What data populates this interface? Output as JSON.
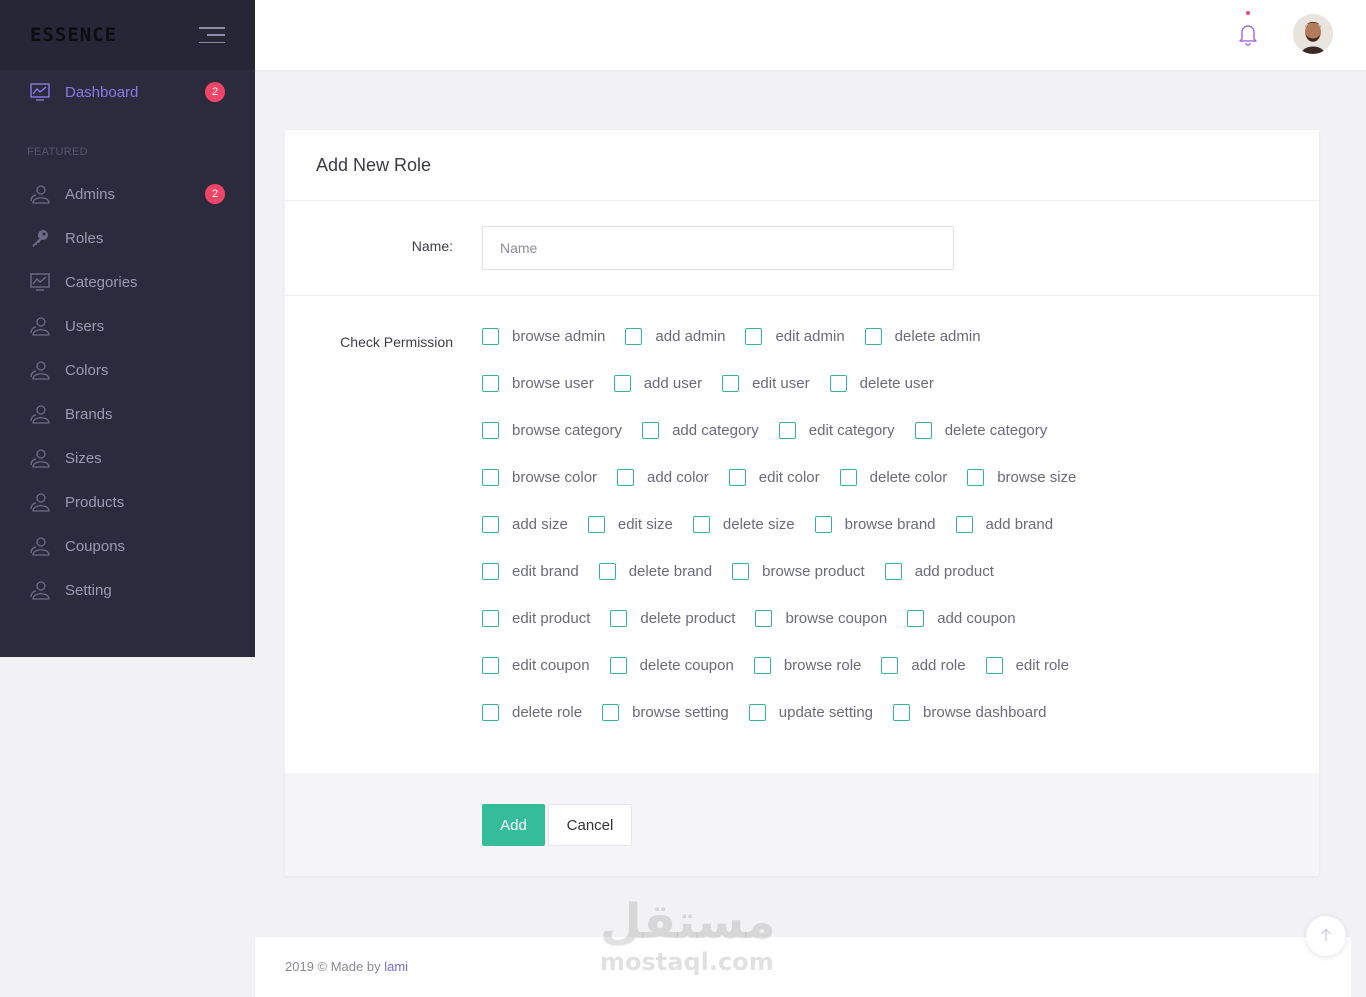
{
  "brand": "ESSENCE",
  "sidebar": {
    "dashboard": {
      "label": "Dashboard",
      "badge": "2"
    },
    "section_title": "FEATURED",
    "items": [
      {
        "label": "Admins",
        "icon": "users-icon",
        "badge": "2"
      },
      {
        "label": "Roles",
        "icon": "key-icon"
      },
      {
        "label": "Categories",
        "icon": "chart-icon"
      },
      {
        "label": "Users",
        "icon": "users-icon"
      },
      {
        "label": "Colors",
        "icon": "users-icon"
      },
      {
        "label": "Brands",
        "icon": "users-icon"
      },
      {
        "label": "Sizes",
        "icon": "users-icon"
      },
      {
        "label": "Products",
        "icon": "users-icon"
      },
      {
        "label": "Coupons",
        "icon": "users-icon"
      },
      {
        "label": "Setting",
        "icon": "users-icon"
      }
    ]
  },
  "form": {
    "title": "Add New Role",
    "name_label": "Name:",
    "name_placeholder": "Name",
    "perm_label": "Check Permission",
    "add_label": "Add",
    "cancel_label": "Cancel",
    "permissions": [
      [
        "browse admin",
        "add admin",
        "edit admin",
        "delete admin"
      ],
      [
        "browse user",
        "add user",
        "edit user",
        "delete user"
      ],
      [
        "browse category",
        "add category",
        "edit category",
        "delete category"
      ],
      [
        "browse color",
        "add color",
        "edit color",
        "delete color",
        "browse size"
      ],
      [
        "add size",
        "edit size",
        "delete size",
        "browse brand",
        "add brand"
      ],
      [
        "edit brand",
        "delete brand",
        "browse product",
        "add product"
      ],
      [
        "edit product",
        "delete product",
        "browse coupon",
        "add coupon"
      ],
      [
        "edit coupon",
        "delete coupon",
        "browse role",
        "add role",
        "edit role"
      ],
      [
        "delete role",
        "browse setting",
        "update setting",
        "browse dashboard"
      ]
    ]
  },
  "footer": {
    "prefix": "2019 © Made by ",
    "author": "lami"
  },
  "watermark": {
    "arabic": "مستقل",
    "latin": "mostaql.com"
  },
  "colors": {
    "sidebar_bg": "#2b2b3d",
    "accent_purple": "#8a7ae6",
    "accent_green": "#34bc9b",
    "badge_red": "#ef4566"
  }
}
